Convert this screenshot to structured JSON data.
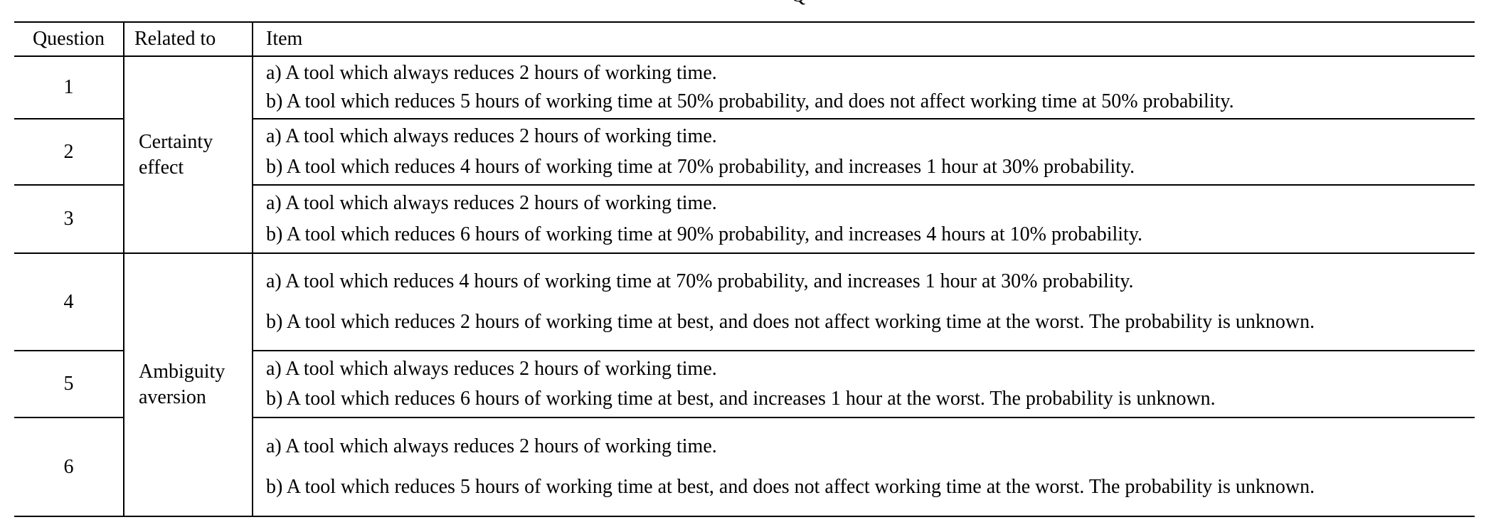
{
  "caption_fragment": "Q",
  "headers": {
    "question": "Question",
    "related": "Related to",
    "item": "Item"
  },
  "groups": [
    {
      "related": "Certainty effect",
      "rows": [
        {
          "q": "1",
          "a": "a) A tool which always reduces 2 hours of working time.",
          "b": "b) A tool which reduces 5 hours of working time at 50% probability, and does not affect working time at 50% probability."
        },
        {
          "q": "2",
          "a": "a) A tool which always reduces 2 hours of working time.",
          "b": "b) A tool which reduces 4 hours of working time at 70% probability, and increases 1 hour at 30% probability."
        },
        {
          "q": "3",
          "a": "a) A tool which always reduces 2 hours of working time.",
          "b": "b) A tool which reduces 6 hours of working time at 90% probability, and increases 4 hours at 10% probability."
        }
      ]
    },
    {
      "related": "Ambiguity aversion",
      "rows": [
        {
          "q": "4",
          "a": "a) A tool which reduces 4 hours of working time at 70% probability, and increases 1 hour at 30% probability.",
          "b": "b) A tool which reduces 2 hours of working time at best, and does not affect working time at the worst. The probability is unknown."
        },
        {
          "q": "5",
          "a": "a) A tool which always reduces 2 hours of working time.",
          "b": "b) A tool which reduces 6 hours of working time at best, and increases 1 hour at the worst. The probability is unknown."
        },
        {
          "q": "6",
          "a": "a) A tool which always reduces 2 hours of working time.",
          "b": "b) A tool which reduces 5 hours of working time at best, and does not affect working time at the worst. The probability is unknown."
        }
      ]
    }
  ]
}
